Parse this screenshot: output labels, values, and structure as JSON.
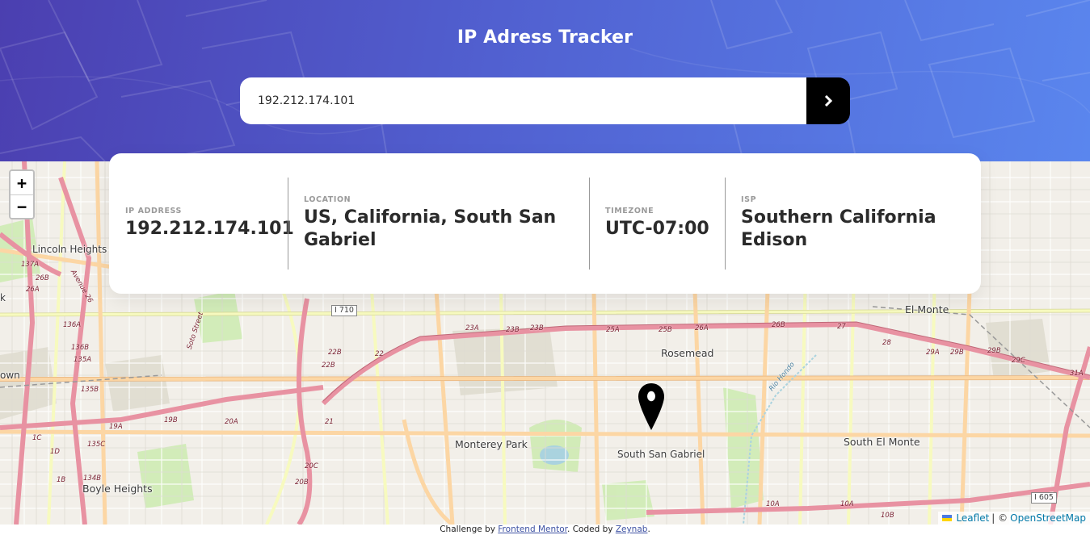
{
  "header": {
    "title": "IP Adress Tracker",
    "search_value": "192.212.174.101",
    "submit_icon": "chevron-right-icon"
  },
  "info": {
    "ip": {
      "label": "IP ADDRESS",
      "value": "192.212.174.101"
    },
    "location": {
      "label": "LOCATION",
      "value": "US, California, South San Gabriel"
    },
    "timezone": {
      "label": "TIMEZONE",
      "value": "UTC-07:00"
    },
    "isp": {
      "label": "ISP",
      "value": "Southern California Edison"
    }
  },
  "map": {
    "zoom_in": "+",
    "zoom_out": "−",
    "marker_icon": "location-pin-icon",
    "places": {
      "lincoln_heights": "Lincoln Heights",
      "el_monte": "El Monte",
      "rosemead": "Rosemead",
      "monterey_park": "Monterey Park",
      "south_san_gabriel": "South San Gabriel",
      "south_el_monte": "South El Monte",
      "boyle_heights": "Boyle Heights",
      "own": "own",
      "k": "k"
    },
    "shields": {
      "i710": "I 710",
      "i605": "I 605"
    },
    "exits": [
      "137A",
      "26B",
      "26A",
      "136A",
      "136B",
      "135A",
      "135C",
      "135B",
      "134B",
      "1B",
      "1C",
      "1D",
      "19B",
      "19A",
      "20A",
      "20C",
      "20B",
      "21",
      "22",
      "22B",
      "22B",
      "23A",
      "23B",
      "23B",
      "25A",
      "25B",
      "26A",
      "26B",
      "27",
      "28",
      "29A",
      "29B",
      "29B",
      "29C",
      "31A",
      "10A",
      "10A",
      "10B",
      "137B"
    ],
    "streets": {
      "soto": "Soto Street",
      "figueroa": "Avenue 26",
      "rio_hondo": "Rio Hondo"
    },
    "attribution": {
      "leaflet": "Leaflet",
      "separator": "| ©",
      "osm": "OpenStreetMap"
    }
  },
  "footer": {
    "prefix": "Challenge by",
    "fm_link": "Frontend Mentor",
    "middle": ". Coded by",
    "author_link": "Zeynab",
    "suffix": "."
  },
  "colors": {
    "header_start": "#4b3fb0",
    "header_end": "#5a86ee",
    "button": "#000000",
    "value_text": "#2b2b2b",
    "label_text": "#9a9a9a",
    "motorway": "#e892a2",
    "primary_road": "#fcd6a4",
    "secondary_road": "#f7fabf"
  }
}
